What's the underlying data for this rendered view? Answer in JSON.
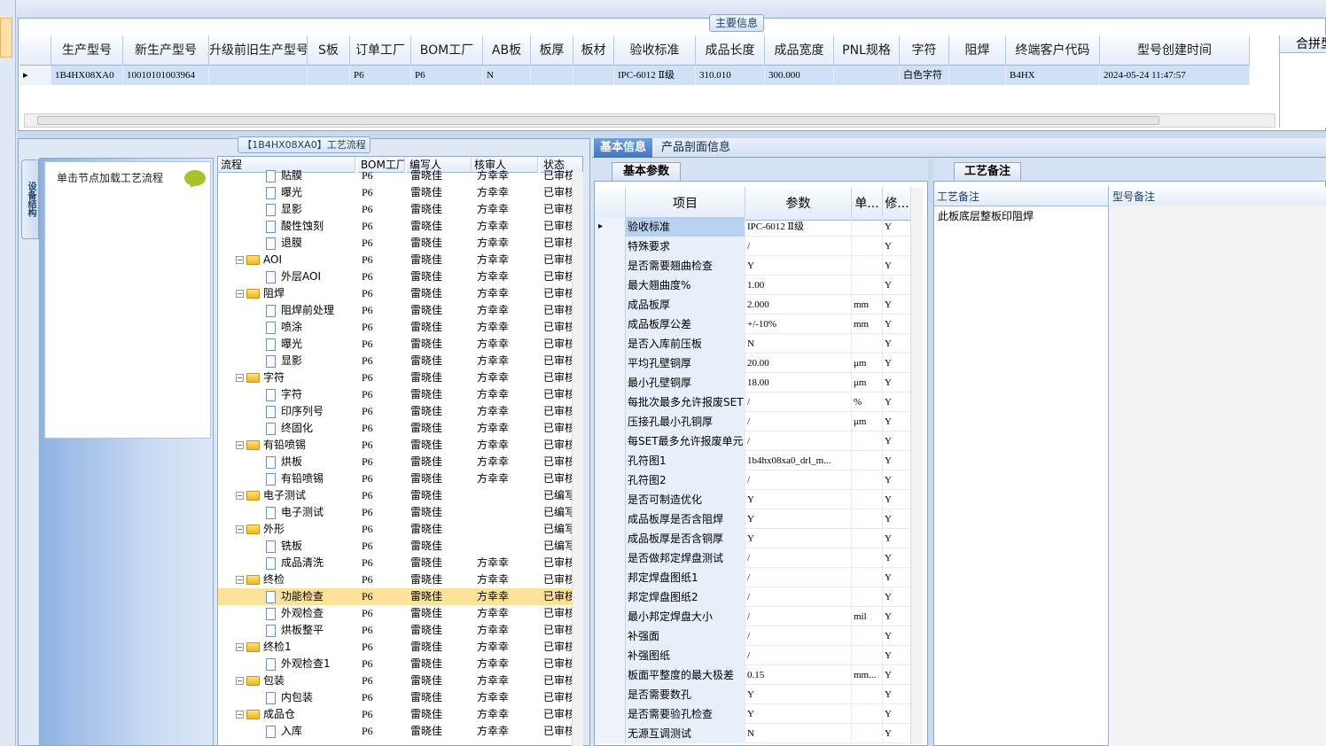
{
  "main_info_tab": "主要信息",
  "product_grid": {
    "headers": [
      "生产型号",
      "新生产型号",
      "升级前旧生产型号",
      "S板",
      "订单工厂",
      "BOM工厂",
      "AB板",
      "板厚",
      "板材",
      "验收标准",
      "成品长度",
      "成品宽度",
      "PNL规格",
      "字符",
      "阻焊",
      "终端客户代码",
      "型号创建时间"
    ],
    "row": [
      "1B4HX08XA0",
      "10010101003964",
      "",
      "",
      "P6",
      "P6",
      "N",
      "",
      "",
      "IPC-6012 Ⅱ级",
      "310.010",
      "300.000",
      "",
      "白色字符",
      "",
      "B4HX",
      "2024-05-24 11:47:57"
    ],
    "extra_header": "合拼型"
  },
  "flow_tab": "【1B4HX08XA0】工艺流程",
  "side_vertical_tab": "设备结构",
  "node_hint": "单击节点加载工艺流程",
  "tree": {
    "headers": [
      "流程",
      "BOM工厂",
      "编写人",
      "核审人",
      "状态"
    ],
    "rows": [
      {
        "name": "贴膜",
        "type": "doc",
        "bom": "P6",
        "writer": "雷晓佳",
        "reviewer": "方幸幸",
        "status": "已审核"
      },
      {
        "name": "曝光",
        "type": "doc",
        "bom": "P6",
        "writer": "雷晓佳",
        "reviewer": "方幸幸",
        "status": "已审核"
      },
      {
        "name": "显影",
        "type": "doc",
        "bom": "P6",
        "writer": "雷晓佳",
        "reviewer": "方幸幸",
        "status": "已审核"
      },
      {
        "name": "酸性蚀刻",
        "type": "doc",
        "bom": "P6",
        "writer": "雷晓佳",
        "reviewer": "方幸幸",
        "status": "已审核"
      },
      {
        "name": "退膜",
        "type": "doc",
        "bom": "P6",
        "writer": "雷晓佳",
        "reviewer": "方幸幸",
        "status": "已审核"
      },
      {
        "name": "AOI",
        "type": "folder",
        "bom": "P6",
        "writer": "雷晓佳",
        "reviewer": "方幸幸",
        "status": "已审核"
      },
      {
        "name": "外层AOI",
        "type": "doc",
        "bom": "P6",
        "writer": "雷晓佳",
        "reviewer": "方幸幸",
        "status": "已审核"
      },
      {
        "name": "阻焊",
        "type": "folder",
        "bom": "P6",
        "writer": "雷晓佳",
        "reviewer": "方幸幸",
        "status": "已审核"
      },
      {
        "name": "阻焊前处理",
        "type": "doc",
        "bom": "P6",
        "writer": "雷晓佳",
        "reviewer": "方幸幸",
        "status": "已审核"
      },
      {
        "name": "喷涂",
        "type": "doc",
        "bom": "P6",
        "writer": "雷晓佳",
        "reviewer": "方幸幸",
        "status": "已审核"
      },
      {
        "name": "曝光",
        "type": "doc",
        "bom": "P6",
        "writer": "雷晓佳",
        "reviewer": "方幸幸",
        "status": "已审核"
      },
      {
        "name": "显影",
        "type": "doc",
        "bom": "P6",
        "writer": "雷晓佳",
        "reviewer": "方幸幸",
        "status": "已审核"
      },
      {
        "name": "字符",
        "type": "folder",
        "bom": "P6",
        "writer": "雷晓佳",
        "reviewer": "方幸幸",
        "status": "已审核"
      },
      {
        "name": "字符",
        "type": "doc",
        "bom": "P6",
        "writer": "雷晓佳",
        "reviewer": "方幸幸",
        "status": "已审核"
      },
      {
        "name": "印序列号",
        "type": "doc",
        "bom": "P6",
        "writer": "雷晓佳",
        "reviewer": "方幸幸",
        "status": "已审核"
      },
      {
        "name": "终固化",
        "type": "doc",
        "bom": "P6",
        "writer": "雷晓佳",
        "reviewer": "方幸幸",
        "status": "已审核"
      },
      {
        "name": "有铅喷锡",
        "type": "folder",
        "bom": "P6",
        "writer": "雷晓佳",
        "reviewer": "方幸幸",
        "status": "已审核"
      },
      {
        "name": "烘板",
        "type": "doc",
        "bom": "P6",
        "writer": "雷晓佳",
        "reviewer": "方幸幸",
        "status": "已审核"
      },
      {
        "name": "有铅喷锡",
        "type": "doc",
        "bom": "P6",
        "writer": "雷晓佳",
        "reviewer": "方幸幸",
        "status": "已审核"
      },
      {
        "name": "电子测试",
        "type": "folder",
        "bom": "P6",
        "writer": "雷晓佳",
        "reviewer": "",
        "status": "已编写"
      },
      {
        "name": "电子测试",
        "type": "doc",
        "bom": "P6",
        "writer": "雷晓佳",
        "reviewer": "",
        "status": "已编写"
      },
      {
        "name": "外形",
        "type": "folder",
        "bom": "P6",
        "writer": "雷晓佳",
        "reviewer": "",
        "status": "已编写"
      },
      {
        "name": "铣板",
        "type": "doc",
        "bom": "P6",
        "writer": "雷晓佳",
        "reviewer": "",
        "status": "已编写"
      },
      {
        "name": "成品清洗",
        "type": "doc",
        "bom": "P6",
        "writer": "雷晓佳",
        "reviewer": "方幸幸",
        "status": "已审核"
      },
      {
        "name": "终检",
        "type": "folder",
        "bom": "P6",
        "writer": "雷晓佳",
        "reviewer": "方幸幸",
        "status": "已审核"
      },
      {
        "name": "功能检查",
        "type": "doc",
        "bom": "P6",
        "writer": "雷晓佳",
        "reviewer": "方幸幸",
        "status": "已审核",
        "selected": true
      },
      {
        "name": "外观检查",
        "type": "doc",
        "bom": "P6",
        "writer": "雷晓佳",
        "reviewer": "方幸幸",
        "status": "已审核"
      },
      {
        "name": "烘板整平",
        "type": "doc",
        "bom": "P6",
        "writer": "雷晓佳",
        "reviewer": "方幸幸",
        "status": "已审核"
      },
      {
        "name": "终检1",
        "type": "folder",
        "bom": "P6",
        "writer": "雷晓佳",
        "reviewer": "方幸幸",
        "status": "已审核"
      },
      {
        "name": "外观检查1",
        "type": "doc",
        "bom": "P6",
        "writer": "雷晓佳",
        "reviewer": "方幸幸",
        "status": "已审核"
      },
      {
        "name": "包装",
        "type": "folder",
        "bom": "P6",
        "writer": "雷晓佳",
        "reviewer": "方幸幸",
        "status": "已审核"
      },
      {
        "name": "内包装",
        "type": "doc",
        "bom": "P6",
        "writer": "雷晓佳",
        "reviewer": "方幸幸",
        "status": "已审核"
      },
      {
        "name": "成品仓",
        "type": "folder",
        "bom": "P6",
        "writer": "雷晓佳",
        "reviewer": "方幸幸",
        "status": "已审核"
      },
      {
        "name": "入库",
        "type": "doc",
        "bom": "P6",
        "writer": "雷晓佳",
        "reviewer": "方幸幸",
        "status": "已审核"
      }
    ]
  },
  "right_tabs": [
    "基本信息",
    "产品剖面信息"
  ],
  "param_tab": "基本参数",
  "param_headers": [
    "项目",
    "参数",
    "单...",
    "修..."
  ],
  "params": [
    {
      "item": "验收标准",
      "value": "IPC-6012 Ⅱ级",
      "unit": "",
      "mod": "Y",
      "selected": true
    },
    {
      "item": "特殊要求",
      "value": "/",
      "unit": "",
      "mod": "Y"
    },
    {
      "item": "是否需要翘曲检查",
      "value": "Y",
      "unit": "",
      "mod": "Y"
    },
    {
      "item": "最大翘曲度%",
      "value": "1.00",
      "unit": "",
      "mod": "Y"
    },
    {
      "item": "成品板厚",
      "value": "2.000",
      "unit": "mm",
      "mod": "Y"
    },
    {
      "item": "成品板厚公差",
      "value": "+/-10%",
      "unit": "mm",
      "mod": "Y"
    },
    {
      "item": "是否入库前压板",
      "value": "N",
      "unit": "",
      "mod": "Y"
    },
    {
      "item": "平均孔壁铜厚",
      "value": "20.00",
      "unit": "μm",
      "mod": "Y"
    },
    {
      "item": "最小孔壁铜厚",
      "value": "18.00",
      "unit": "μm",
      "mod": "Y"
    },
    {
      "item": "每批次最多允许报废SET",
      "value": "/",
      "unit": "%",
      "mod": "Y"
    },
    {
      "item": "压接孔最小孔铜厚",
      "value": "/",
      "unit": "μm",
      "mod": "Y"
    },
    {
      "item": "每SET最多允许报废单元",
      "value": "/",
      "unit": "",
      "mod": "Y"
    },
    {
      "item": "孔符图1",
      "value": "1b4hx08xa0_drl_m...",
      "unit": "",
      "mod": "Y"
    },
    {
      "item": "孔符图2",
      "value": "/",
      "unit": "",
      "mod": "Y"
    },
    {
      "item": "是否可制造优化",
      "value": "Y",
      "unit": "",
      "mod": "Y"
    },
    {
      "item": "成品板厚是否含阻焊",
      "value": "Y",
      "unit": "",
      "mod": "Y"
    },
    {
      "item": "成品板厚是否含铜厚",
      "value": "Y",
      "unit": "",
      "mod": "Y"
    },
    {
      "item": "是否做邦定焊盘测试",
      "value": "/",
      "unit": "",
      "mod": "Y"
    },
    {
      "item": "邦定焊盘图纸1",
      "value": "/",
      "unit": "",
      "mod": "Y"
    },
    {
      "item": "邦定焊盘图纸2",
      "value": "/",
      "unit": "",
      "mod": "Y"
    },
    {
      "item": "最小邦定焊盘大小",
      "value": "/",
      "unit": "mil",
      "mod": "Y"
    },
    {
      "item": "补强面",
      "value": "/",
      "unit": "",
      "mod": "Y"
    },
    {
      "item": "补强图纸",
      "value": "/",
      "unit": "",
      "mod": "Y"
    },
    {
      "item": "板面平整度的最大极差",
      "value": "0.15",
      "unit": "mm...",
      "mod": "Y"
    },
    {
      "item": "是否需要数孔",
      "value": "Y",
      "unit": "",
      "mod": "Y"
    },
    {
      "item": "是否需要验孔检查",
      "value": "Y",
      "unit": "",
      "mod": "Y"
    },
    {
      "item": "无源互调测试",
      "value": "N",
      "unit": "",
      "mod": "Y"
    }
  ],
  "note_tab": "工艺备注",
  "note_headers": [
    "工艺备注",
    "型号备注"
  ],
  "note_text": "此板底层整板印阻焊"
}
